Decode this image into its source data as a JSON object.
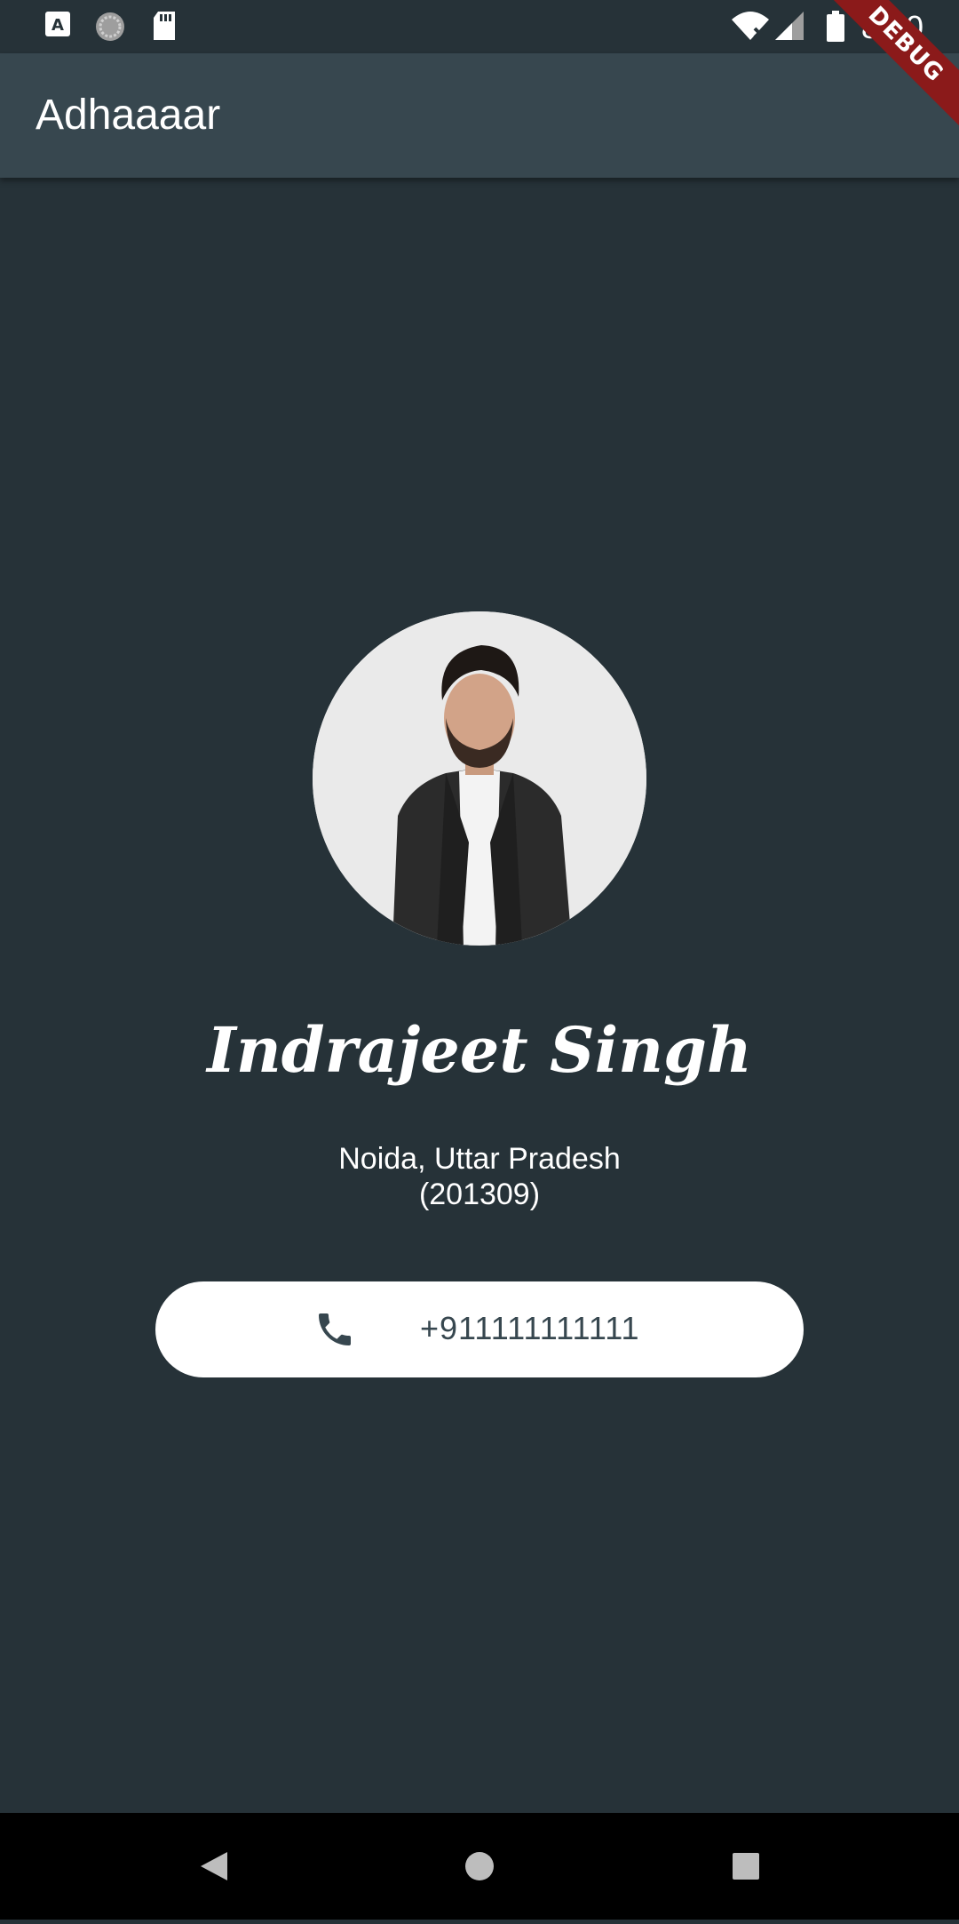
{
  "status_bar": {
    "time": "8:20",
    "icons_left": [
      "font-icon",
      "sync-icon",
      "sd-card-icon"
    ],
    "icons_right": [
      "wifi-off-icon",
      "cell-signal-icon",
      "battery-icon"
    ]
  },
  "app_bar": {
    "title": "Adhaaaar"
  },
  "debug_banner": "DEBUG",
  "profile": {
    "name": "Indrajeet Singh",
    "address_line1": "Noida, Uttar Pradesh",
    "address_line2": "(201309)",
    "phone": "+911111111111"
  },
  "nav_bar": {
    "buttons": [
      "back-icon",
      "home-icon",
      "recents-icon"
    ]
  },
  "colors": {
    "background": "#263238",
    "app_bar": "#37474f",
    "button": "#ffffff",
    "phone_text": "#37474f"
  }
}
